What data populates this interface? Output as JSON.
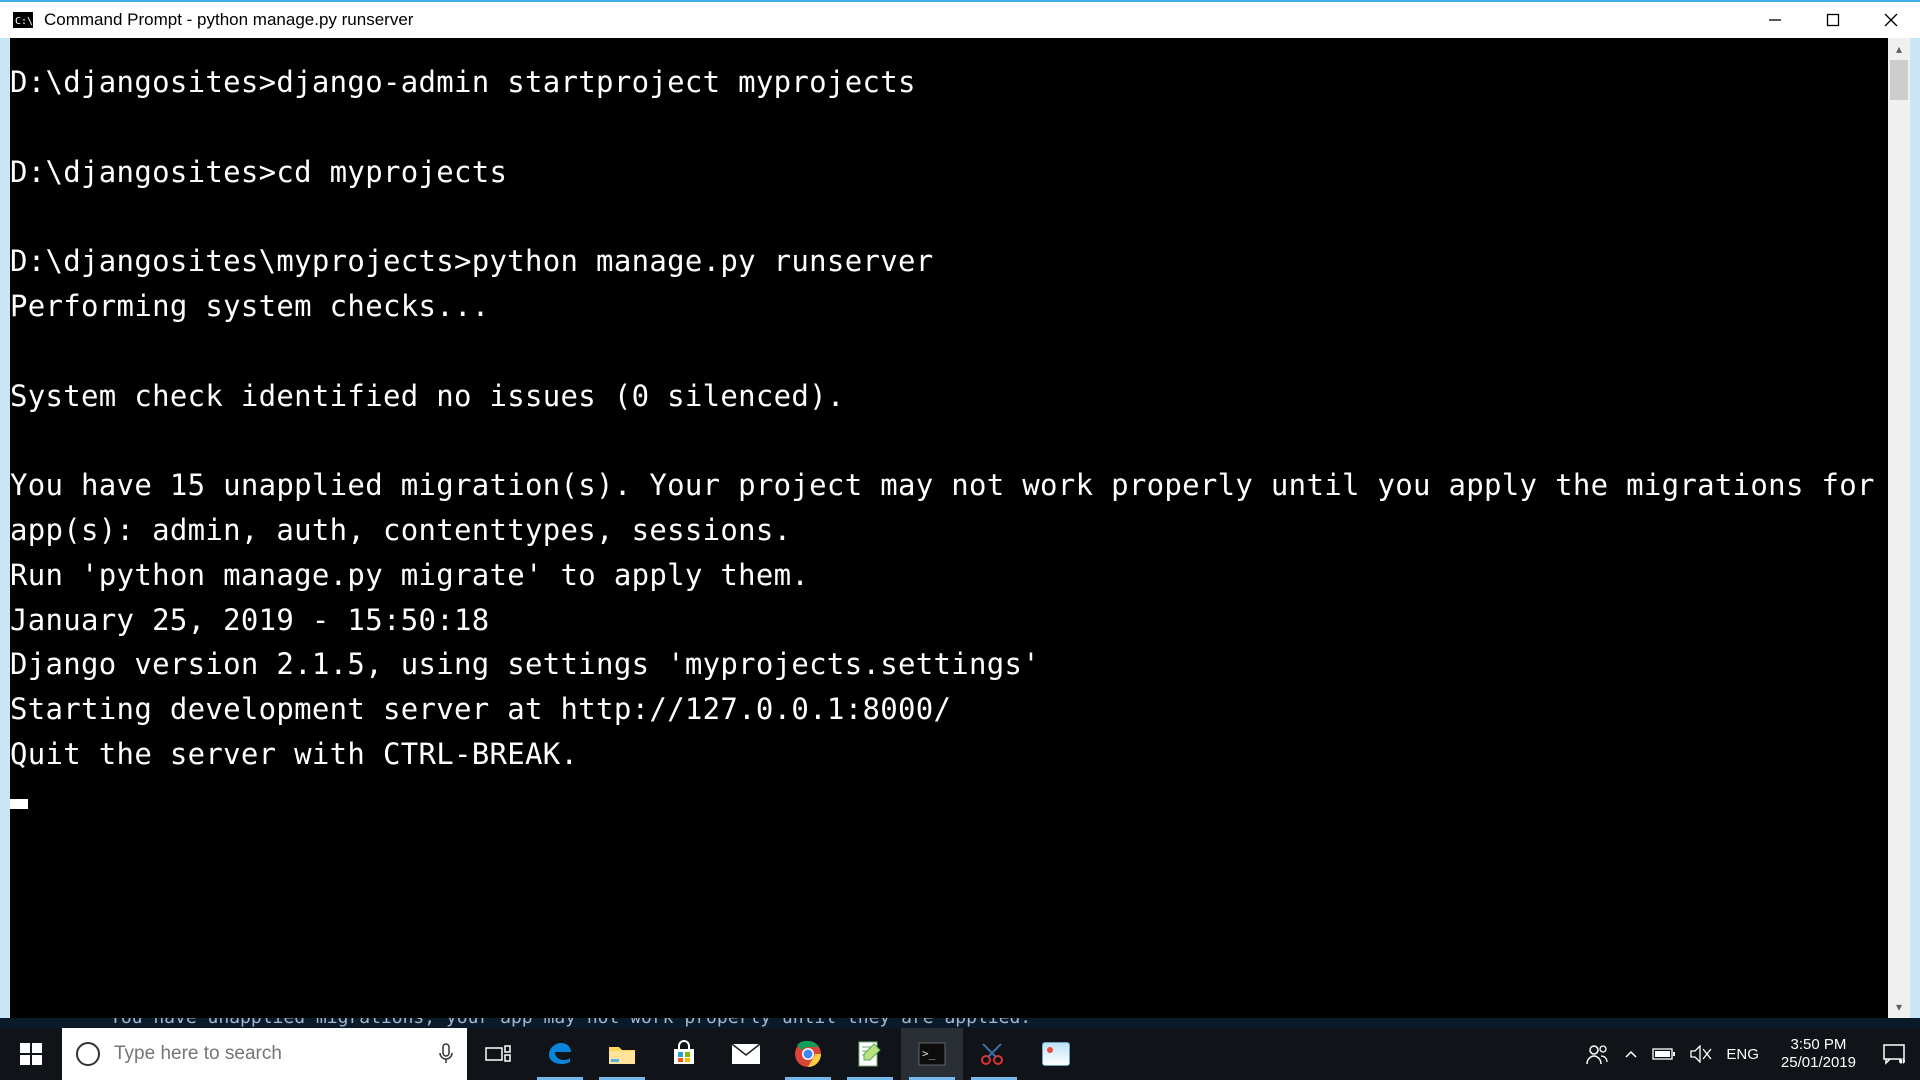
{
  "window": {
    "title": "Command Prompt - python  manage.py runserver"
  },
  "terminal": {
    "lines": [
      "D:\\djangosites>django-admin startproject myprojects",
      "",
      "D:\\djangosites>cd myprojects",
      "",
      "D:\\djangosites\\myprojects>python manage.py runserver",
      "Performing system checks...",
      "",
      "System check identified no issues (0 silenced).",
      "",
      "You have 15 unapplied migration(s). Your project may not work properly until you apply the migrations for app(s): admin, auth, contenttypes, sessions.",
      "Run 'python manage.py migrate' to apply them.",
      "January 25, 2019 - 15:50:18",
      "Django version 2.1.5, using settings 'myprojects.settings'",
      "Starting development server at http://127.0.0.1:8000/",
      "Quit the server with CTRL-BREAK."
    ]
  },
  "background_strip": "You have unapplied migrations; your app may not work properly until they are applied.",
  "taskbar": {
    "search_placeholder": "Type here to search",
    "language": "ENG",
    "time": "3:50 PM",
    "date": "25/01/2019"
  }
}
